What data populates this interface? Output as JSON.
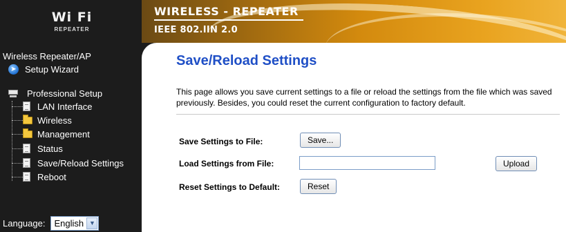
{
  "header": {
    "logo_text": "Wi Fi",
    "logo_subtext": "REPEATER",
    "title": "WIRELESS - REPEATER",
    "subtitle": "IEEE 802.IIN 2.0"
  },
  "sidebar": {
    "title": "Wireless Repeater/AP",
    "wizard_label": "Setup Wizard",
    "professional_label": "Professional Setup",
    "items": [
      {
        "label": "LAN Interface",
        "icon": "document-icon"
      },
      {
        "label": "Wireless",
        "icon": "folder-icon"
      },
      {
        "label": "Management",
        "icon": "folder-icon"
      },
      {
        "label": "Status",
        "icon": "document-icon"
      },
      {
        "label": "Save/Reload Settings",
        "icon": "document-icon"
      },
      {
        "label": "Reboot",
        "icon": "document-icon"
      }
    ],
    "language_label": "Language:",
    "language_value": "English"
  },
  "main": {
    "title": "Save/Reload Settings",
    "description": "This page allows you save current settings to a file or reload the settings from the file which was saved previously. Besides, you could reset the current configuration to factory default.",
    "save_label": "Save Settings to File:",
    "save_button": "Save...",
    "load_label": "Load Settings from File:",
    "load_value": "",
    "upload_button": "Upload",
    "reset_label": "Reset Settings to Default:",
    "reset_button": "Reset"
  },
  "colors": {
    "title_blue": "#1f4fc6",
    "sidebar_bg": "#1c1c1c",
    "header_orange": "#d38a0e"
  }
}
